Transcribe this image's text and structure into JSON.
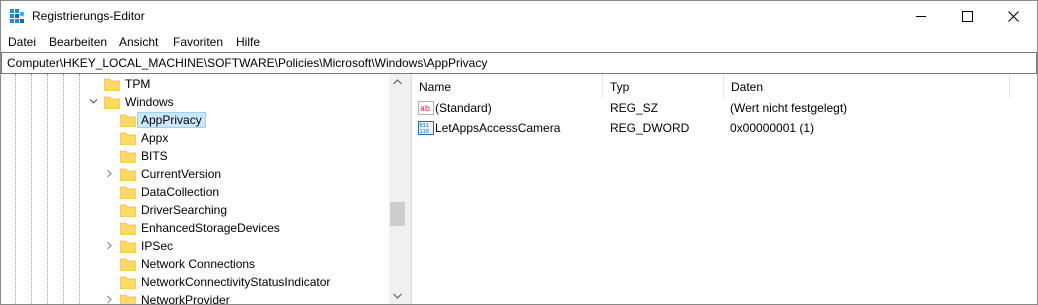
{
  "window": {
    "title": "Registrierungs-Editor",
    "app_icon": "registry-editor-icon",
    "controls": [
      "minimize-icon",
      "maximize-icon",
      "close-icon"
    ]
  },
  "menu": {
    "items": [
      {
        "label": "Datei"
      },
      {
        "label": "Bearbeiten"
      },
      {
        "label": "Ansicht"
      },
      {
        "label": "Favoriten"
      },
      {
        "label": "Hilfe"
      }
    ]
  },
  "address": {
    "path": "Computer\\HKEY_LOCAL_MACHINE\\SOFTWARE\\Policies\\Microsoft\\Windows\\AppPrivacy"
  },
  "tree": {
    "items": [
      {
        "label": "TPM",
        "level": 1,
        "expander": "none"
      },
      {
        "label": "Windows",
        "level": 1,
        "expander": "expanded"
      },
      {
        "label": "AppPrivacy",
        "level": 2,
        "expander": "none",
        "selected": true
      },
      {
        "label": "Appx",
        "level": 2,
        "expander": "none"
      },
      {
        "label": "BITS",
        "level": 2,
        "expander": "none"
      },
      {
        "label": "CurrentVersion",
        "level": 2,
        "expander": "collapsed"
      },
      {
        "label": "DataCollection",
        "level": 2,
        "expander": "none"
      },
      {
        "label": "DriverSearching",
        "level": 2,
        "expander": "none"
      },
      {
        "label": "EnhancedStorageDevices",
        "level": 2,
        "expander": "none"
      },
      {
        "label": "IPSec",
        "level": 2,
        "expander": "collapsed"
      },
      {
        "label": "Network Connections",
        "level": 2,
        "expander": "none"
      },
      {
        "label": "NetworkConnectivityStatusIndicator",
        "level": 2,
        "expander": "none"
      },
      {
        "label": "NetworkProvider",
        "level": 2,
        "expander": "collapsed"
      }
    ]
  },
  "list": {
    "columns": [
      "Name",
      "Typ",
      "Daten"
    ],
    "rows": [
      {
        "icon": "string-value-icon",
        "name": "(Standard)",
        "type": "REG_SZ",
        "data": "(Wert nicht festgelegt)"
      },
      {
        "icon": "dword-value-icon",
        "name": "LetAppsAccessCamera",
        "type": "REG_DWORD",
        "data": "0x00000001 (1)"
      }
    ]
  },
  "colors": {
    "selection_bg": "#cce8ff",
    "selection_border": "#99d1ff",
    "folder_yellow": "#ffd966",
    "folder_dark": "#e8b84a"
  }
}
